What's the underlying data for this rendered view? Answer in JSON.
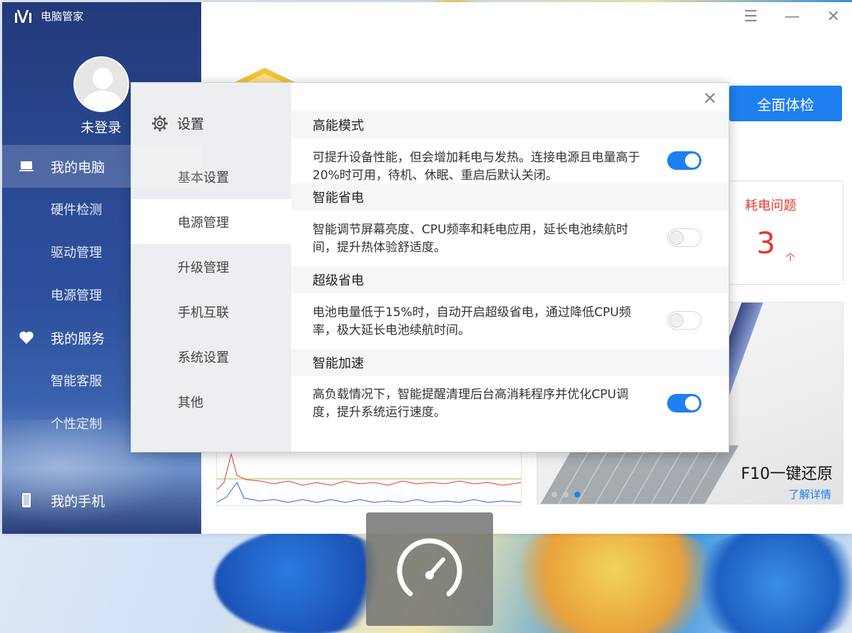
{
  "app": {
    "title": "电脑管家",
    "login_label": "未登录",
    "full_check_label": "全面体检"
  },
  "sidebar": {
    "items": [
      {
        "label": "我的电脑",
        "icon": "laptop-icon",
        "type": "main",
        "active": true
      },
      {
        "label": "硬件检测",
        "type": "sub"
      },
      {
        "label": "驱动管理",
        "type": "sub"
      },
      {
        "label": "电源管理",
        "type": "sub"
      },
      {
        "label": "我的服务",
        "icon": "heart-icon",
        "type": "main"
      },
      {
        "label": "智能客服",
        "type": "sub"
      },
      {
        "label": "个性定制",
        "type": "sub"
      }
    ],
    "phone_label": "我的手机"
  },
  "window_controls": [
    "menu-icon",
    "minimize-icon",
    "close-icon"
  ],
  "power_card": {
    "title": "耗电问题",
    "count": "3",
    "unit": "个"
  },
  "promo": {
    "title": "F10一键还原",
    "link": "了解详情"
  },
  "dialog": {
    "title": "设置",
    "menu": [
      {
        "label": "基本设置",
        "active": false
      },
      {
        "label": "电源管理",
        "active": true
      },
      {
        "label": "升级管理",
        "active": false
      },
      {
        "label": "手机互联",
        "active": false
      },
      {
        "label": "系统设置",
        "active": false
      },
      {
        "label": "其他",
        "active": false
      }
    ],
    "sections": [
      {
        "title": "高能模式",
        "desc": "可提升设备性能，但会增加耗电与发热。连接电源且电量高于20%时可用，待机、休眠、重启后默认关闭。",
        "enabled": true
      },
      {
        "title": "智能省电",
        "desc": "智能调节屏幕亮度、CPU频率和耗电应用，延长电池续航时间，提升热体验舒适度。",
        "enabled": false
      },
      {
        "title": "超级省电",
        "desc": "电池电量低于15%时，自动开启超级省电，通过降低CPU频率，极大延长电池续航时间。",
        "enabled": false
      },
      {
        "title": "智能加速",
        "desc": "高负载情况下，智能提醒清理后台高消耗程序并优化CPU调度，提升系统运行速度。",
        "enabled": true
      }
    ]
  },
  "colors": {
    "accent": "#1e7ff0",
    "alert": "#e53b32",
    "sidebar": "#2b4a94"
  }
}
